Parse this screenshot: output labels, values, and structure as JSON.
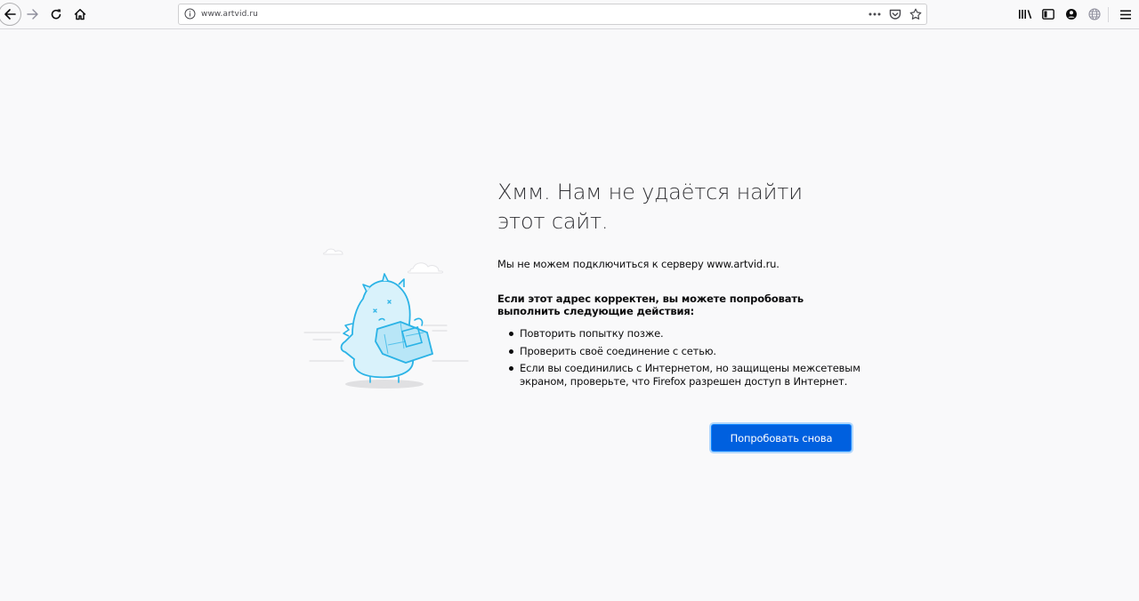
{
  "browser": {
    "url": "www.artvid.ru",
    "icons": [
      "back-icon",
      "forward-icon",
      "reload-icon",
      "home-icon",
      "info-icon",
      "more-icon",
      "pocket-icon",
      "bookmark-star-icon",
      "library-icon",
      "sidebar-icon",
      "account-icon",
      "globe-icon",
      "menu-icon"
    ]
  },
  "error": {
    "title": "Хмм. Нам не удаётся найти этот сайт.",
    "intro": "Мы не можем подключиться к серверу www.artvid.ru.",
    "advice_heading": "Если этот адрес корректен, вы можете попробовать выполнить следующие действия:",
    "suggestions": [
      "Повторить попытку позже.",
      "Проверить своё соединение с сетью.",
      "Если вы соединились с Интернетом, но защищены межсетевым экраном, проверьте, что Firefox разрешен доступ в Интернет."
    ],
    "try_again_label": "Попробовать снова"
  },
  "colors": {
    "page_bg": "#f9f9fa",
    "button_bg": "#0060df",
    "illustration": "#2bb3e6"
  }
}
